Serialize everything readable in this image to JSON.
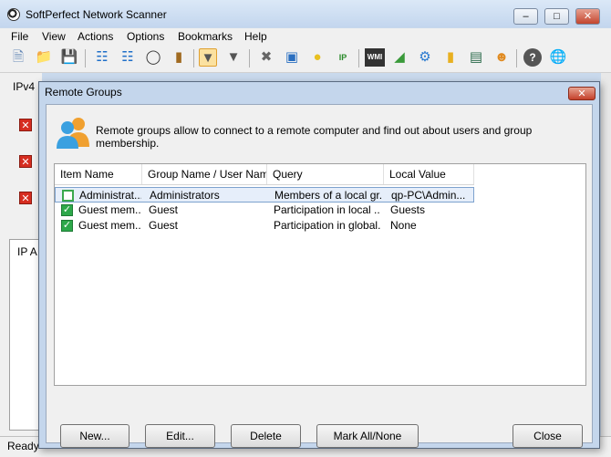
{
  "window": {
    "title": "SoftPerfect Network Scanner"
  },
  "menu": [
    "File",
    "View",
    "Actions",
    "Options",
    "Bookmarks",
    "Help"
  ],
  "toolbar_icons": [
    "new-icon",
    "open-icon",
    "save-icon",
    "expand-icon",
    "collapse-icon",
    "find-icon",
    "clipboard-icon",
    "filter-icon",
    "funnel-icon",
    "tools-icon",
    "monitor-icon",
    "bulb-icon",
    "ip-icon",
    "wmi-icon",
    "green-icon",
    "gear-icon",
    "folder-icon",
    "network-icon",
    "users-icon",
    "help-icon",
    "globe-icon"
  ],
  "background": {
    "ipv4_label": "IPv4",
    "ip_label": "IP A",
    "status": "Ready"
  },
  "dialog": {
    "title": "Remote Groups",
    "description": "Remote groups allow to connect to a remote computer and find out about users and group membership.",
    "columns": [
      "Item Name",
      "Group Name / User Name",
      "Query",
      "Local Value"
    ],
    "rows": [
      {
        "checked": false,
        "item": "Administrat...",
        "group": "Administrators",
        "query": "Members of a local gr...",
        "value": "qp-PC\\Admin..."
      },
      {
        "checked": true,
        "item": "Guest mem...",
        "group": "Guest",
        "query": "Participation in local ...",
        "value": "Guests"
      },
      {
        "checked": true,
        "item": "Guest mem...",
        "group": "Guest",
        "query": "Participation in global...",
        "value": "None"
      }
    ],
    "buttons": {
      "new": "New...",
      "edit": "Edit...",
      "delete": "Delete",
      "mark": "Mark All/None",
      "close": "Close"
    }
  }
}
